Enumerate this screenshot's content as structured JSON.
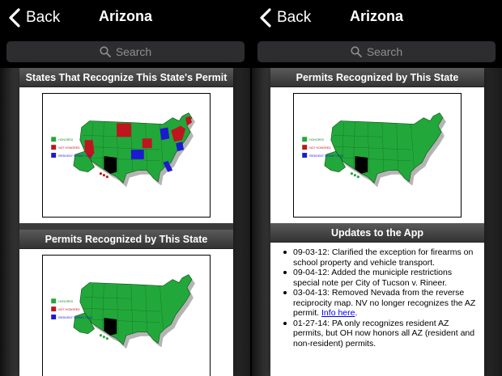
{
  "left": {
    "nav": {
      "back_label": "Back",
      "title": "Arizona"
    },
    "search": {
      "placeholder": "Search"
    },
    "sections": [
      {
        "header": "States That Recognize This State's Permit"
      },
      {
        "header": "Permits Recognized by This State"
      }
    ]
  },
  "right": {
    "nav": {
      "back_label": "Back",
      "title": "Arizona"
    },
    "search": {
      "placeholder": "Search"
    },
    "sections": [
      {
        "header": "Permits Recognized by This State"
      },
      {
        "header": "Updates to the App"
      }
    ],
    "updates": [
      {
        "text": "09-03-12: Clarified the exception for firearms on school property and vehicle transport."
      },
      {
        "text": "09-04-12: Added the municiple restrictions special note per City of Tucson v. Rineer."
      },
      {
        "text": "03-04-13: Removed Nevada from the reverse reciprocity map. NV no longer recognizes the AZ permit.",
        "link": "Info here",
        "after": "."
      },
      {
        "text": "01-27-14: PA only recognizes resident AZ permits, but OH now honors all AZ (resident and non-resident) permits."
      }
    ]
  },
  "legend": {
    "honored": "HONORED",
    "not_honored": "NOT HONORED",
    "resident_only": "RESIDENT PERMIT ONLY"
  },
  "colors": {
    "green": "#22a83a",
    "red": "#c0141e",
    "blue": "#1a1ad0",
    "black": "#000000",
    "nav_bg": "#000000"
  },
  "icons": {
    "back": "chevron-left-icon",
    "search": "magnifier-icon"
  }
}
